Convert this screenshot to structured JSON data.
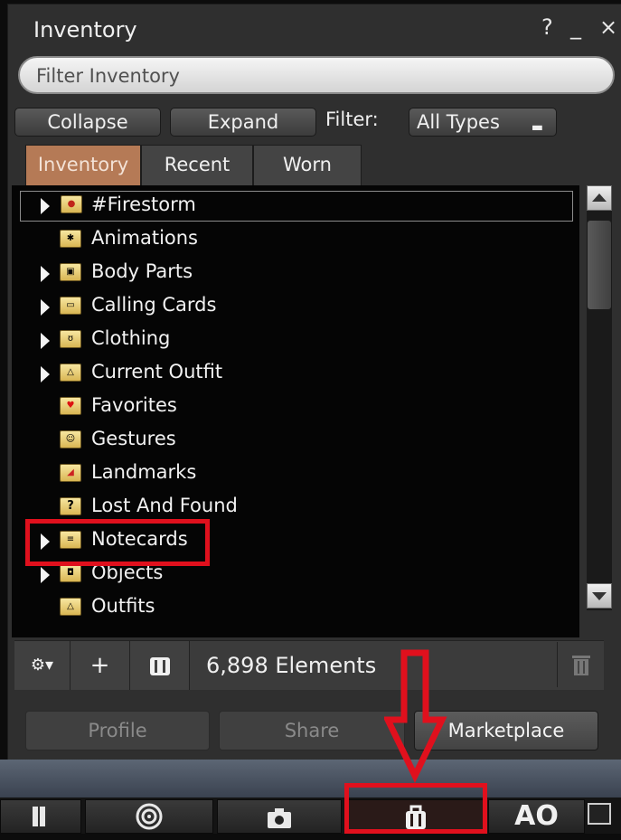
{
  "window": {
    "title": "Inventory",
    "help": "?",
    "minimize": "_",
    "close": "×"
  },
  "search": {
    "placeholder": "Filter Inventory"
  },
  "controls": {
    "collapse": "Collapse",
    "expand": "Expand",
    "filter_label": "Filter:",
    "filter_value": "All Types"
  },
  "tabs": [
    {
      "label": "Inventory",
      "active": true
    },
    {
      "label": "Recent",
      "active": false
    },
    {
      "label": "Worn",
      "active": false
    }
  ],
  "tree": [
    {
      "label": "#Firestorm",
      "icon": "firestorm-folder-icon",
      "expandable": true,
      "selected": true
    },
    {
      "label": "Animations",
      "icon": "animations-folder-icon",
      "expandable": false
    },
    {
      "label": "Body Parts",
      "icon": "body-parts-folder-icon",
      "expandable": true
    },
    {
      "label": "Calling Cards",
      "icon": "calling-cards-folder-icon",
      "expandable": true
    },
    {
      "label": "Clothing",
      "icon": "clothing-folder-icon",
      "expandable": true
    },
    {
      "label": "Current Outfit",
      "icon": "current-outfit-folder-icon",
      "expandable": true
    },
    {
      "label": "Favorites",
      "icon": "favorites-folder-icon",
      "expandable": false
    },
    {
      "label": "Gestures",
      "icon": "gestures-folder-icon",
      "expandable": false
    },
    {
      "label": "Landmarks",
      "icon": "landmarks-folder-icon",
      "expandable": false
    },
    {
      "label": "Lost And Found",
      "icon": "lost-and-found-folder-icon",
      "expandable": false
    },
    {
      "label": "Notecards",
      "icon": "notecards-folder-icon",
      "expandable": true,
      "highlighted": true
    },
    {
      "label": "Objects",
      "icon": "objects-folder-icon",
      "expandable": true
    },
    {
      "label": "Outfits",
      "icon": "outfits-folder-icon",
      "expandable": false
    }
  ],
  "bottom": {
    "gear": "⚙▾",
    "add": "+",
    "element_count": "6,898 Elements"
  },
  "actions": {
    "profile": "Profile",
    "share": "Share",
    "marketplace": "Marketplace"
  },
  "toolbar": {
    "ao": "AO"
  },
  "colors": {
    "highlight": "#e0101d",
    "active_tab": "#b57a56"
  }
}
